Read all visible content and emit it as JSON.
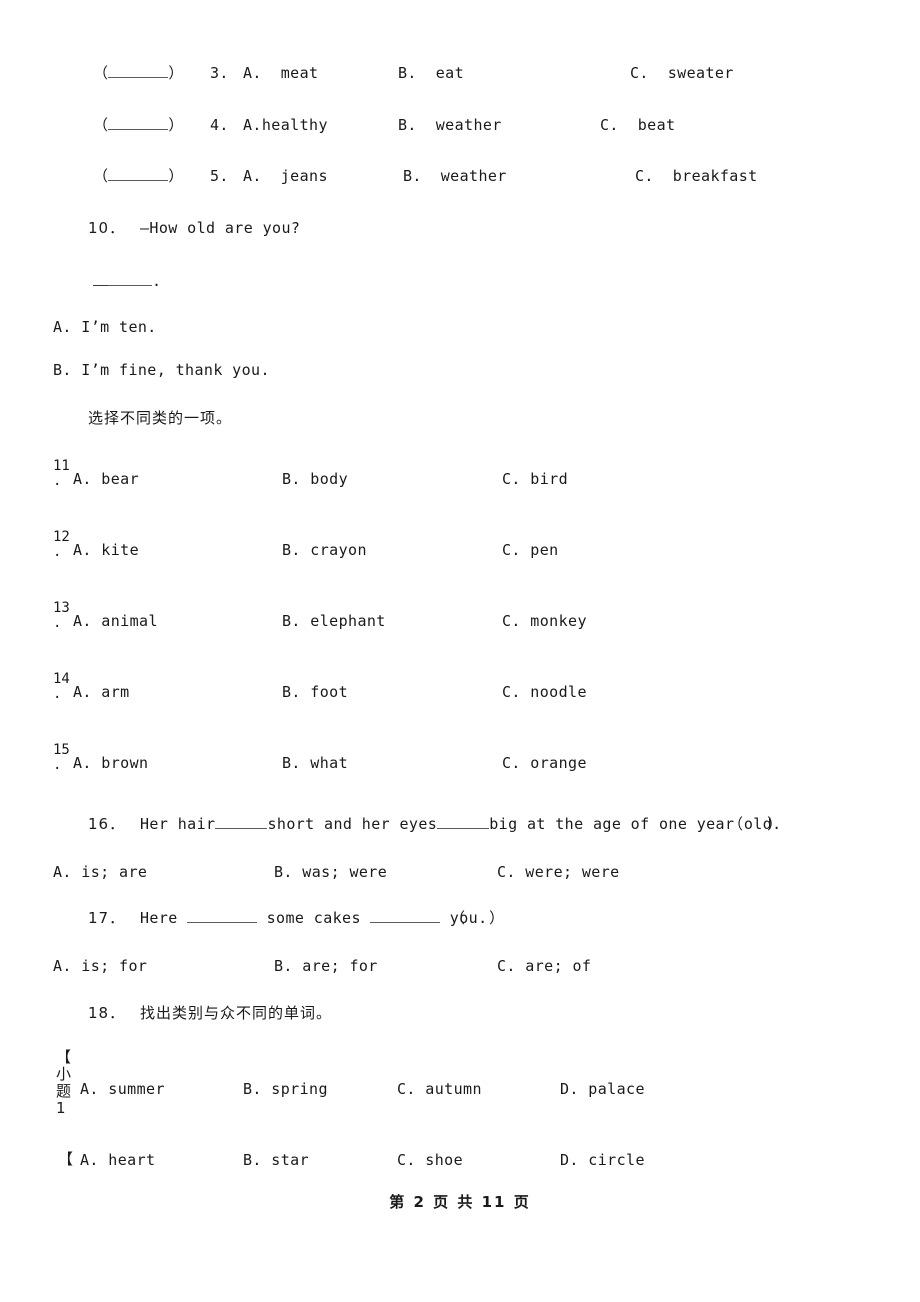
{
  "document": {
    "type": "exam-worksheet",
    "background": "#ffffff",
    "text_color": "#1a1a1a"
  },
  "bracket_rows": [
    {
      "open_paren": "（",
      "close_paren": "）",
      "number": "3.",
      "a": "A.  meat",
      "b": "B.  eat",
      "c": "C.  sweater"
    },
    {
      "open_paren": "（",
      "close_paren": "）",
      "number": "4.",
      "a": "A.healthy",
      "b": "B.  weather",
      "c": "C.  beat"
    },
    {
      "open_paren": "（",
      "close_paren": "）",
      "number": "5.",
      "a": "A.  jeans",
      "b": "B.  weather",
      "c": "C.  breakfast"
    }
  ],
  "question10": {
    "number": "10．",
    "prompt": "—How old are you?",
    "answer_line_suffix": ".",
    "options": [
      "A. I’m ten.",
      "B. I’m fine, thank you."
    ]
  },
  "section_instruction": "选择不同类的一项。",
  "odd_one_out": [
    {
      "num": "11",
      "dot": ".",
      "a": "A. bear",
      "b": "B. body",
      "c": "C. bird"
    },
    {
      "num": "12",
      "dot": ".",
      "a": "A. kite",
      "b": "B. crayon",
      "c": "C. pen"
    },
    {
      "num": "13",
      "dot": ".",
      "a": "A. animal",
      "b": "B. elephant",
      "c": "C. monkey"
    },
    {
      "num": "14",
      "dot": ".",
      "a": "A. arm",
      "b": "B. foot",
      "c": "C. noodle"
    },
    {
      "num": "15",
      "dot": ".",
      "a": "A. brown",
      "b": "B. what",
      "c": "C. orange"
    }
  ],
  "question16": {
    "number": "16．",
    "text_part1": "Her hair",
    "text_part2": "short and her eyes",
    "text_part3": "big at the age of one year old.",
    "paren": "（    ）",
    "options": [
      "A. is; are",
      "B. was; were",
      "C. were; were"
    ]
  },
  "question17": {
    "number": "17．",
    "text_part1": "Here",
    "text_part2": "some cakes",
    "text_part3": "you.",
    "paren": "（    ）",
    "options": [
      "A. is; for",
      "B. are; for",
      "C. are; of"
    ]
  },
  "question18": {
    "number": "18．",
    "instruction": "找出类别与众不同的单词。"
  },
  "sub_questions": [
    {
      "marker_bracket": "【",
      "marker_char1": "小",
      "marker_char2": "题1",
      "a": "A. summer",
      "b": "B. spring",
      "c": "C. autumn",
      "d": "D. palace"
    },
    {
      "marker_bracket": "【",
      "marker_char1": "",
      "marker_char2": "",
      "a": "A. heart",
      "b": "B. star",
      "c": "C. shoe",
      "d": "D. circle"
    }
  ],
  "footer": {
    "text": "第 2 页 共 11 页"
  }
}
